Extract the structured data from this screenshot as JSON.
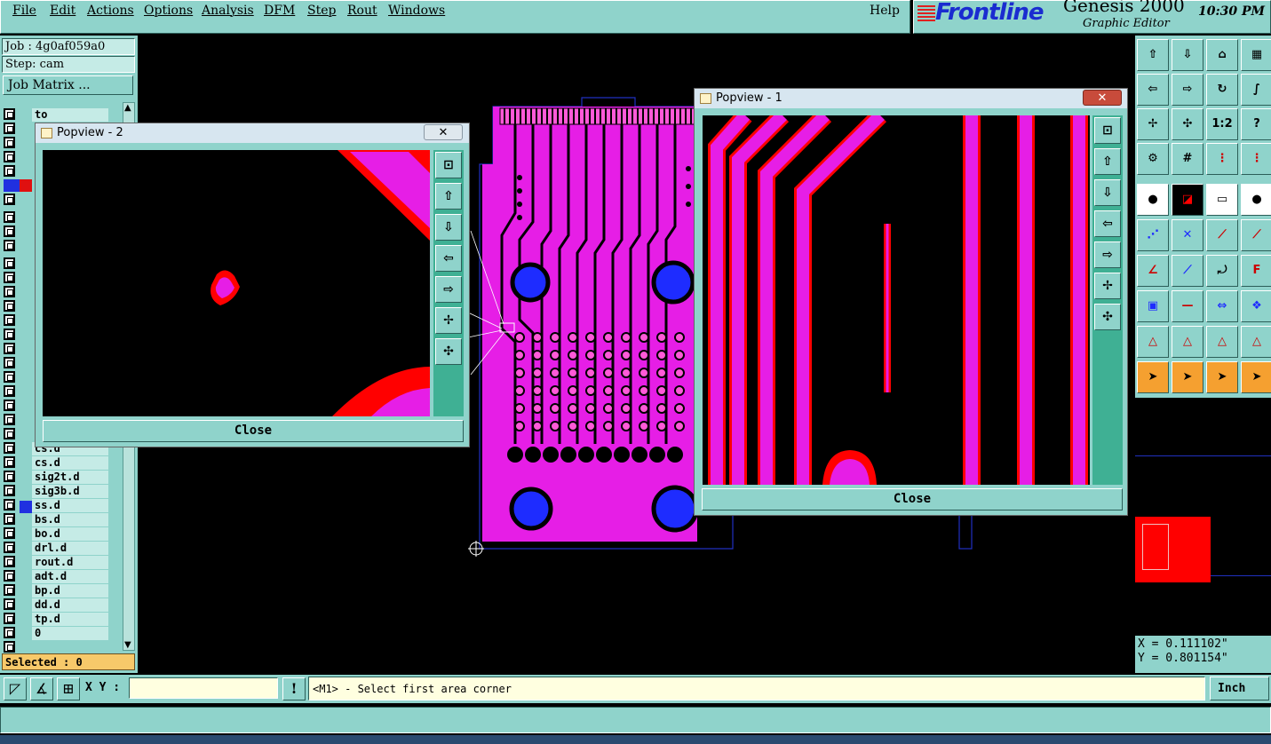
{
  "menubar": {
    "items": [
      "File",
      "Edit",
      "Actions",
      "Options",
      "Analysis",
      "DFM",
      "Step",
      "Rout",
      "Windows"
    ],
    "help": "Help"
  },
  "brand": {
    "logo": "Frontline",
    "product": "Genesis 2000",
    "subtitle": "Graphic Editor",
    "time": "10:30 PM"
  },
  "job": {
    "job_label": "Job : 4g0af059a0",
    "step_label": "Step: cam",
    "matrix_button": "Job Matrix ..."
  },
  "layers": {
    "top_name": "to",
    "names": [
      "cs.d",
      "cs.d",
      "sig2t.d",
      "sig3b.d",
      "ss.d",
      "bs.d",
      "bo.d",
      "drl.d",
      "rout.d",
      "adt.d",
      "bp.d",
      "dd.d",
      "tp.d",
      "0"
    ],
    "selected_label": "Selected : 0"
  },
  "popview2": {
    "title": "Popview - 2",
    "close_x": "✕",
    "close_button": "Close"
  },
  "popview1": {
    "title": "Popview - 1",
    "close_x": "✕",
    "close_button": "Close"
  },
  "right_tools": {
    "scale_label": "1:2"
  },
  "coords": {
    "x": "X = 0.111102\"",
    "y": "Y = 0.801154\""
  },
  "bottom": {
    "xy_label": "X Y :",
    "xy_value": "",
    "prompt": "<M1> - Select first area corner",
    "unit": "Inch"
  },
  "colors": {
    "panel": "#8fd3cb",
    "magenta": "#e61ee6",
    "pad_blue": "#1e2cff",
    "red": "#ff0000"
  }
}
